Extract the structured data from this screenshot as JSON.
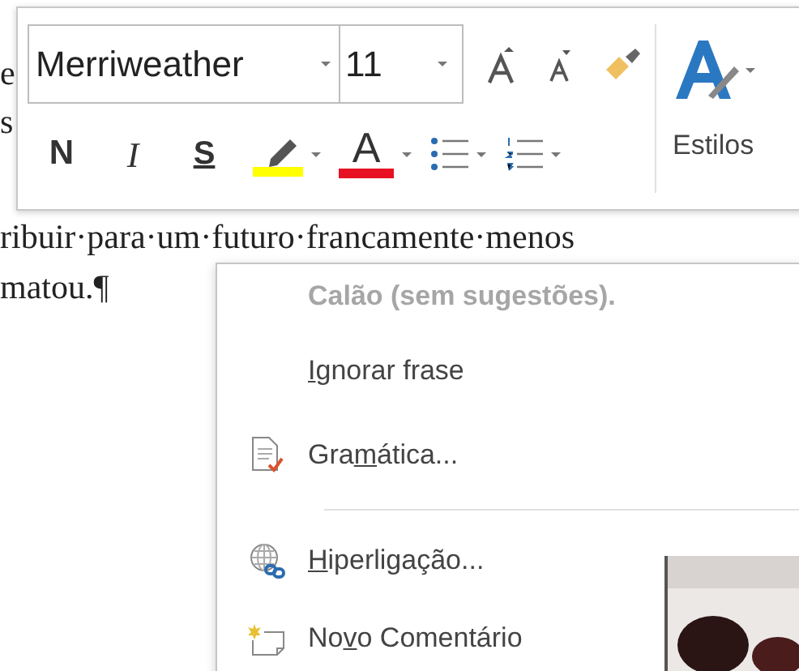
{
  "document": {
    "lines": [
      "e",
      "s",
      "ribuir·para·um·futuro·francamente·menos",
      "matou.¶"
    ]
  },
  "mini_toolbar": {
    "font": {
      "value": "Merriweather"
    },
    "size": {
      "value": "11"
    },
    "styles_label": "Estilos",
    "row2": [
      {
        "kind": "bold",
        "label": "N"
      },
      {
        "kind": "italic",
        "label": "I"
      },
      {
        "kind": "underline",
        "label": "S"
      },
      {
        "kind": "highlight",
        "color": "#ffff00"
      },
      {
        "kind": "font_color",
        "label": "A",
        "color": "#e81123"
      },
      {
        "kind": "bullets"
      },
      {
        "kind": "numbering"
      }
    ]
  },
  "context_menu": {
    "items": [
      {
        "kind": "header",
        "before": "Calão (sem sugestões)."
      },
      {
        "kind": "command",
        "key": "I",
        "after": "gnorar frase"
      },
      {
        "kind": "grammar",
        "before": "Gra",
        "key": "m",
        "after": "ática..."
      },
      {
        "kind": "separator"
      },
      {
        "kind": "hyperlink",
        "key": "H",
        "after": "iperligação..."
      },
      {
        "kind": "comment",
        "before": "No",
        "key": "v",
        "after": "o Comentário"
      }
    ]
  }
}
